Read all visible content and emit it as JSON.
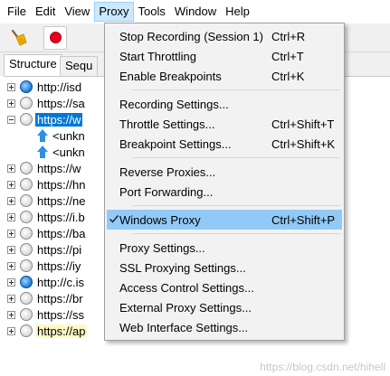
{
  "menubar": {
    "items": [
      "File",
      "Edit",
      "View",
      "Proxy",
      "Tools",
      "Window",
      "Help"
    ],
    "active": "Proxy"
  },
  "toolbar": {
    "icons": [
      "broom-icon",
      "record-icon"
    ]
  },
  "tabs": [
    "Structure",
    "Sequ"
  ],
  "tree": {
    "rows": [
      {
        "text": "http://isd",
        "icon": "globe-blue",
        "state": "collapsed"
      },
      {
        "text": "https://sa",
        "icon": "globe-lock",
        "state": "collapsed"
      },
      {
        "text": "https://w",
        "icon": "globe-lock",
        "state": "expanded",
        "selected": true
      },
      {
        "text": "https://w",
        "icon": "globe-lock",
        "state": "collapsed"
      },
      {
        "text": "https://hn",
        "icon": "globe-lock",
        "state": "collapsed"
      },
      {
        "text": "https://ne",
        "icon": "globe-lock",
        "state": "collapsed"
      },
      {
        "text": "https://i.b",
        "icon": "globe-lock",
        "state": "collapsed"
      },
      {
        "text": "https://ba",
        "icon": "globe-lock",
        "state": "collapsed"
      },
      {
        "text": "https://pi",
        "icon": "globe-lock",
        "state": "collapsed"
      },
      {
        "text": "https://iy",
        "icon": "globe-lock",
        "state": "collapsed"
      },
      {
        "text": "http://c.is",
        "icon": "globe-blue",
        "state": "collapsed"
      },
      {
        "text": "https://br",
        "icon": "globe-lock",
        "state": "collapsed"
      },
      {
        "text": "https://ss",
        "icon": "globe-lock",
        "state": "collapsed"
      },
      {
        "text": "https://ap",
        "icon": "globe-lock",
        "state": "collapsed",
        "highlight": true
      }
    ],
    "children": [
      "<unkn",
      "<unkn"
    ]
  },
  "proxy_menu": {
    "groups": [
      [
        {
          "label": "Stop Recording (Session 1)",
          "shortcut": "Ctrl+R"
        },
        {
          "label": "Start Throttling",
          "shortcut": "Ctrl+T"
        },
        {
          "label": "Enable Breakpoints",
          "shortcut": "Ctrl+K"
        }
      ],
      [
        {
          "label": "Recording Settings...",
          "shortcut": ""
        },
        {
          "label": "Throttle Settings...",
          "shortcut": "Ctrl+Shift+T"
        },
        {
          "label": "Breakpoint Settings...",
          "shortcut": "Ctrl+Shift+K"
        }
      ],
      [
        {
          "label": "Reverse Proxies...",
          "shortcut": ""
        },
        {
          "label": "Port Forwarding...",
          "shortcut": ""
        }
      ],
      [
        {
          "label": "Windows Proxy",
          "shortcut": "Ctrl+Shift+P",
          "checked": true,
          "highlighted": true
        }
      ],
      [
        {
          "label": "Proxy Settings...",
          "shortcut": ""
        },
        {
          "label": "SSL Proxying Settings...",
          "shortcut": ""
        },
        {
          "label": "Access Control Settings...",
          "shortcut": ""
        },
        {
          "label": "External Proxy Settings...",
          "shortcut": ""
        },
        {
          "label": "Web Interface Settings...",
          "shortcut": ""
        }
      ]
    ]
  },
  "watermark": "https://blog.csdn.net/hihell",
  "colors": {
    "menu_highlight": "#91c9f7",
    "selection": "#0078d7",
    "record_red": "#e8001c"
  }
}
